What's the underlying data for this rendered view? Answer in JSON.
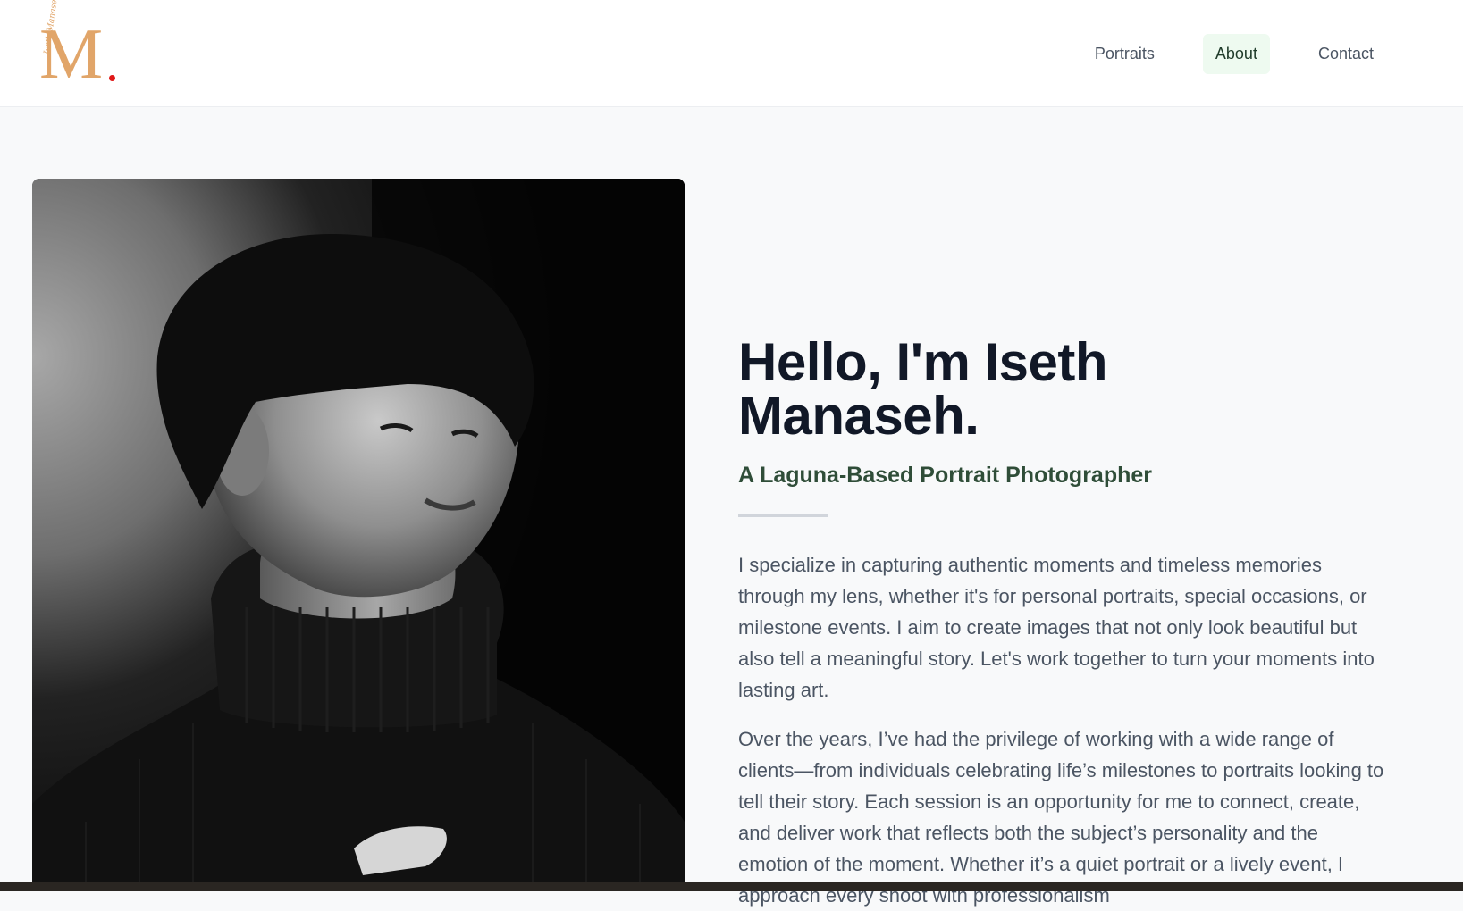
{
  "header": {
    "logo_letter": "M",
    "logo_script": "Iseth Manaseh",
    "nav": [
      {
        "label": "Portraits",
        "active": false
      },
      {
        "label": "About",
        "active": true
      },
      {
        "label": "Contact",
        "active": false
      }
    ]
  },
  "about": {
    "photo_alt": "Black and white portrait of a young man in a turtleneck",
    "title": "Hello, I'm Iseth Manaseh.",
    "subtitle": "A Laguna-Based Portrait Photographer",
    "paragraphs": [
      "I specialize in capturing authentic moments and timeless memories through my lens, whether it's for personal portraits, special occasions, or milestone events. I aim to create images that not only look beautiful but also tell a meaningful story. Let's work together to turn your moments into lasting art.",
      "Over the years, I’ve had the privilege of working with a wide range of clients—from individuals celebrating life’s milestones to portraits looking to tell their story. Each session is an opportunity for me to connect, create, and deliver work that reflects both the subject’s personality and the emotion of the moment. Whether it’s a quiet portrait or a lively event, I approach every shoot with professionalism"
    ]
  },
  "colors": {
    "accent_gold": "#e1a569",
    "logo_dot": "#e01818",
    "nav_active_bg": "#eefaf0",
    "subtitle_green": "#2f4d38"
  }
}
